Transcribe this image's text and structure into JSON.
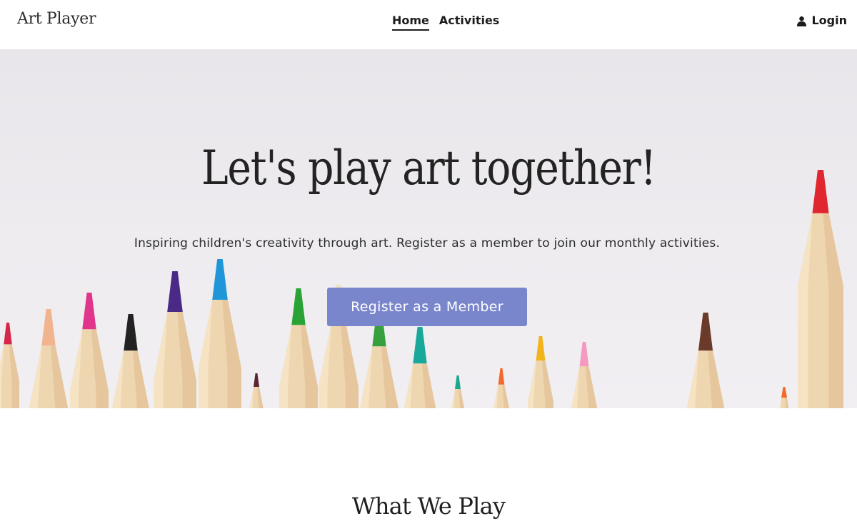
{
  "brand": {
    "name": "Art Player"
  },
  "nav": {
    "links": [
      {
        "label": "Home",
        "active": true
      },
      {
        "label": "Activities",
        "active": false
      }
    ],
    "login_label": "Login"
  },
  "hero": {
    "title": "Let's play art together!",
    "subtitle": "Inspiring children's creativity through art. Register as a member to join our monthly activities.",
    "cta_label": "Register as a Member"
  },
  "section": {
    "title": "What We Play"
  },
  "colors": {
    "accent": "#7a86cc",
    "text": "#1f1f1f",
    "hero_bg": "#ecebee",
    "pencil_wood": "#ecd3ab"
  },
  "icons": {
    "login": "user-icon"
  }
}
